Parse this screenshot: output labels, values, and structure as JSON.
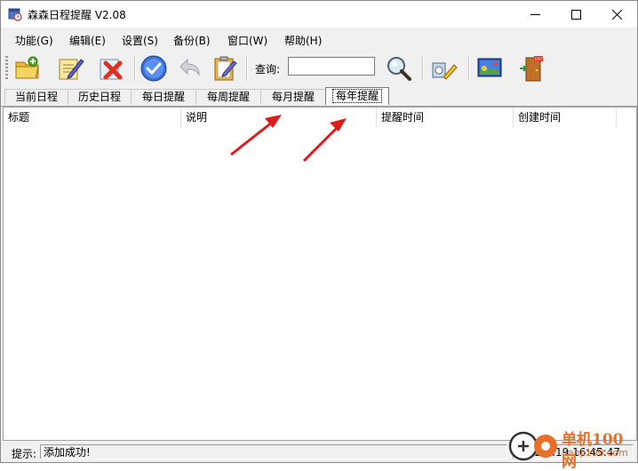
{
  "window": {
    "title": "森森日程提醒 V2.08"
  },
  "menu": [
    "功能(G)",
    "编辑(E)",
    "设置(S)",
    "备份(B)",
    "窗口(W)",
    "帮助(H)"
  ],
  "toolbar": {
    "search_label": "查询:",
    "search_value": ""
  },
  "tabs": [
    "当前日程",
    "历史日程",
    "每日提醒",
    "每周提醒",
    "每月提醒",
    "每年提醒"
  ],
  "active_tab": "每年提醒",
  "columns": [
    "标题",
    "说明",
    "提醒时间",
    "创建时间"
  ],
  "status": {
    "label": "提示:",
    "message": "添加成功!",
    "time": "2022-...19 16:45:47"
  },
  "watermark": {
    "name": "单机100网",
    "url": "danji100.com"
  },
  "colors": {
    "accent_arrow": "#e01a1a",
    "watermark": "#e8702a"
  }
}
